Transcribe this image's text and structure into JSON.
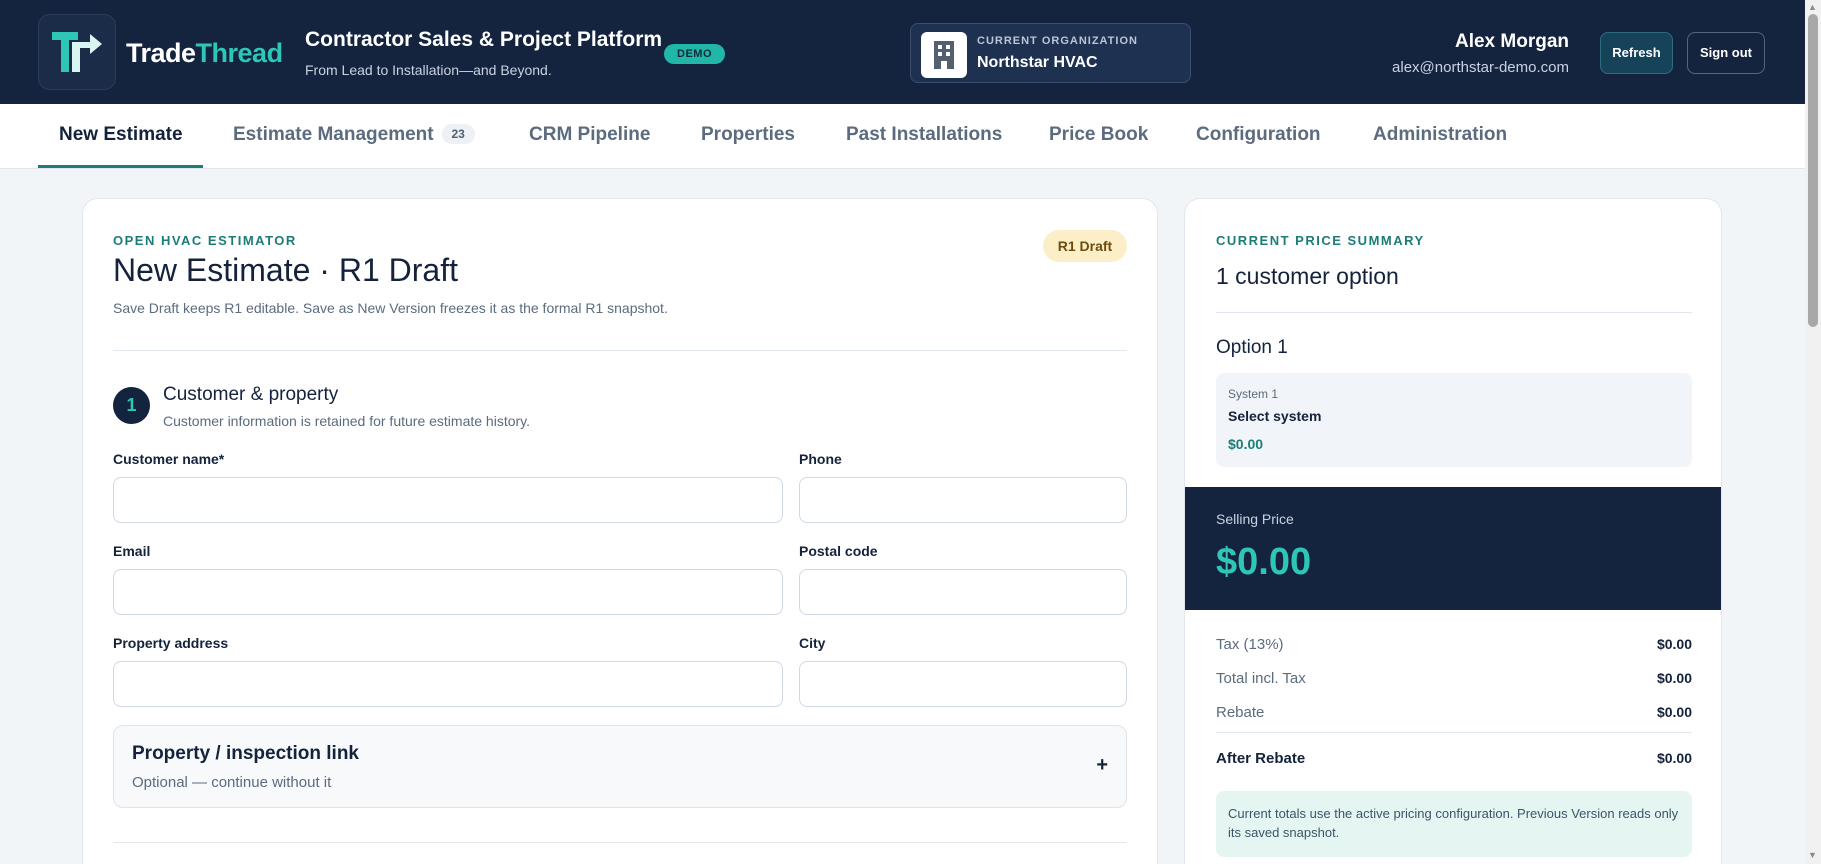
{
  "brand": {
    "part1": "Trade",
    "part2": "Thread"
  },
  "header": {
    "title": "Contractor Sales & Project Platform",
    "subtitle": "From Lead to Installation—and Beyond.",
    "demo_badge": "DEMO",
    "org_label": "CURRENT ORGANIZATION",
    "org_name": "Northstar HVAC",
    "user_name": "Alex Morgan",
    "user_email": "alex@northstar-demo.com",
    "refresh_label": "Refresh",
    "signout_label": "Sign out"
  },
  "tabs": [
    {
      "label": "New Estimate",
      "active": true
    },
    {
      "label": "Estimate Management",
      "count": "23"
    },
    {
      "label": "CRM Pipeline"
    },
    {
      "label": "Properties"
    },
    {
      "label": "Past Installations"
    },
    {
      "label": "Price Book"
    },
    {
      "label": "Configuration"
    },
    {
      "label": "Administration"
    }
  ],
  "estimate": {
    "eyebrow": "OPEN HVAC ESTIMATOR",
    "title": "New Estimate · R1 Draft",
    "description": "Save Draft keeps R1 editable. Save as New Version freezes it as the formal R1 snapshot.",
    "status_badge": "R1 Draft",
    "step_number": "1",
    "step_title": "Customer & property",
    "step_description": "Customer information is retained for future estimate history.",
    "fields": {
      "customer_name": {
        "label": "Customer name*",
        "value": ""
      },
      "phone": {
        "label": "Phone",
        "value": ""
      },
      "email": {
        "label": "Email",
        "value": ""
      },
      "postal_code": {
        "label": "Postal code",
        "value": ""
      },
      "property_address": {
        "label": "Property address",
        "value": ""
      },
      "city": {
        "label": "City",
        "value": ""
      }
    },
    "link_section": {
      "title": "Property / inspection link",
      "subtitle": "Optional — continue without it",
      "toggle": "+"
    }
  },
  "summary": {
    "eyebrow": "CURRENT PRICE SUMMARY",
    "title": "1 customer option",
    "option_title": "Option 1",
    "system": {
      "label": "System 1",
      "name": "Select system",
      "price": "$0.00"
    },
    "selling_price_label": "Selling Price",
    "selling_price": "$0.00",
    "rows": [
      {
        "label": "Tax (13%)",
        "value": "$0.00"
      },
      {
        "label": "Total incl. Tax",
        "value": "$0.00"
      },
      {
        "label": "Rebate",
        "value": "$0.00"
      },
      {
        "label": "After Rebate",
        "value": "$0.00"
      }
    ],
    "note": "Current totals use the active pricing configuration. Previous Version reads only its saved snapshot."
  },
  "colors": {
    "header_bg": "#14243f",
    "accent_teal": "#2ec7b6",
    "accent_dark_teal": "#1c7d77",
    "draft_badge_bg": "#fcefc8"
  }
}
